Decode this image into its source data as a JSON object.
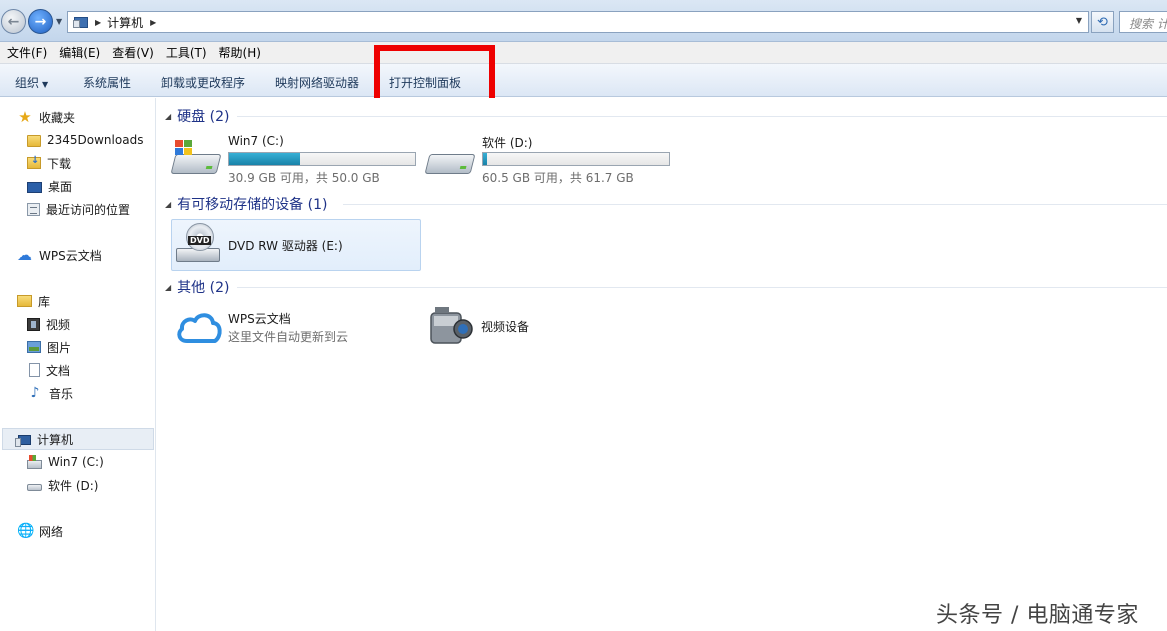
{
  "window": {
    "address_crumb": "计算机",
    "search_placeholder": "搜索 计算机"
  },
  "menu": [
    "文件(F)",
    "编辑(E)",
    "查看(V)",
    "工具(T)",
    "帮助(H)"
  ],
  "toolbar": {
    "organize": "组织",
    "system_properties": "系统属性",
    "uninstall": "卸载或更改程序",
    "map_drive": "映射网络驱动器",
    "open_control_panel": "打开控制面板"
  },
  "sidebar": {
    "favorites": "收藏夹",
    "fav_items": [
      "2345Downloads",
      "下载",
      "桌面",
      "最近访问的位置"
    ],
    "wps_cloud": "WPS云文档",
    "libraries": "库",
    "lib_items": [
      "视频",
      "图片",
      "文档",
      "音乐"
    ],
    "computer": "计算机",
    "computer_items": [
      "Win7 (C:)",
      "软件 (D:)"
    ],
    "network": "网络"
  },
  "groups": {
    "hard_disks": "硬盘 (2)",
    "removable": "有可移动存储的设备 (1)",
    "other": "其他 (2)"
  },
  "drives": [
    {
      "name": "Win7 (C:)",
      "info": "30.9 GB 可用，共 50.0 GB",
      "used_fraction": 0.382
    },
    {
      "name": "软件 (D:)",
      "info": "60.5 GB 可用，共 61.7 GB",
      "used_fraction": 0.019
    }
  ],
  "removable_device": {
    "name": "DVD RW 驱动器 (E:)",
    "badge": "DVD"
  },
  "other_items": {
    "wps_title": "WPS云文档",
    "wps_subtitle": "这里文件自动更新到云",
    "video_device": "视频设备"
  },
  "watermark": "头条号 / 电脑通专家",
  "colors": {
    "highlight_box": "#ee0000",
    "group_header": "#1e3287",
    "drive_bar_fill": "#1882a8"
  }
}
